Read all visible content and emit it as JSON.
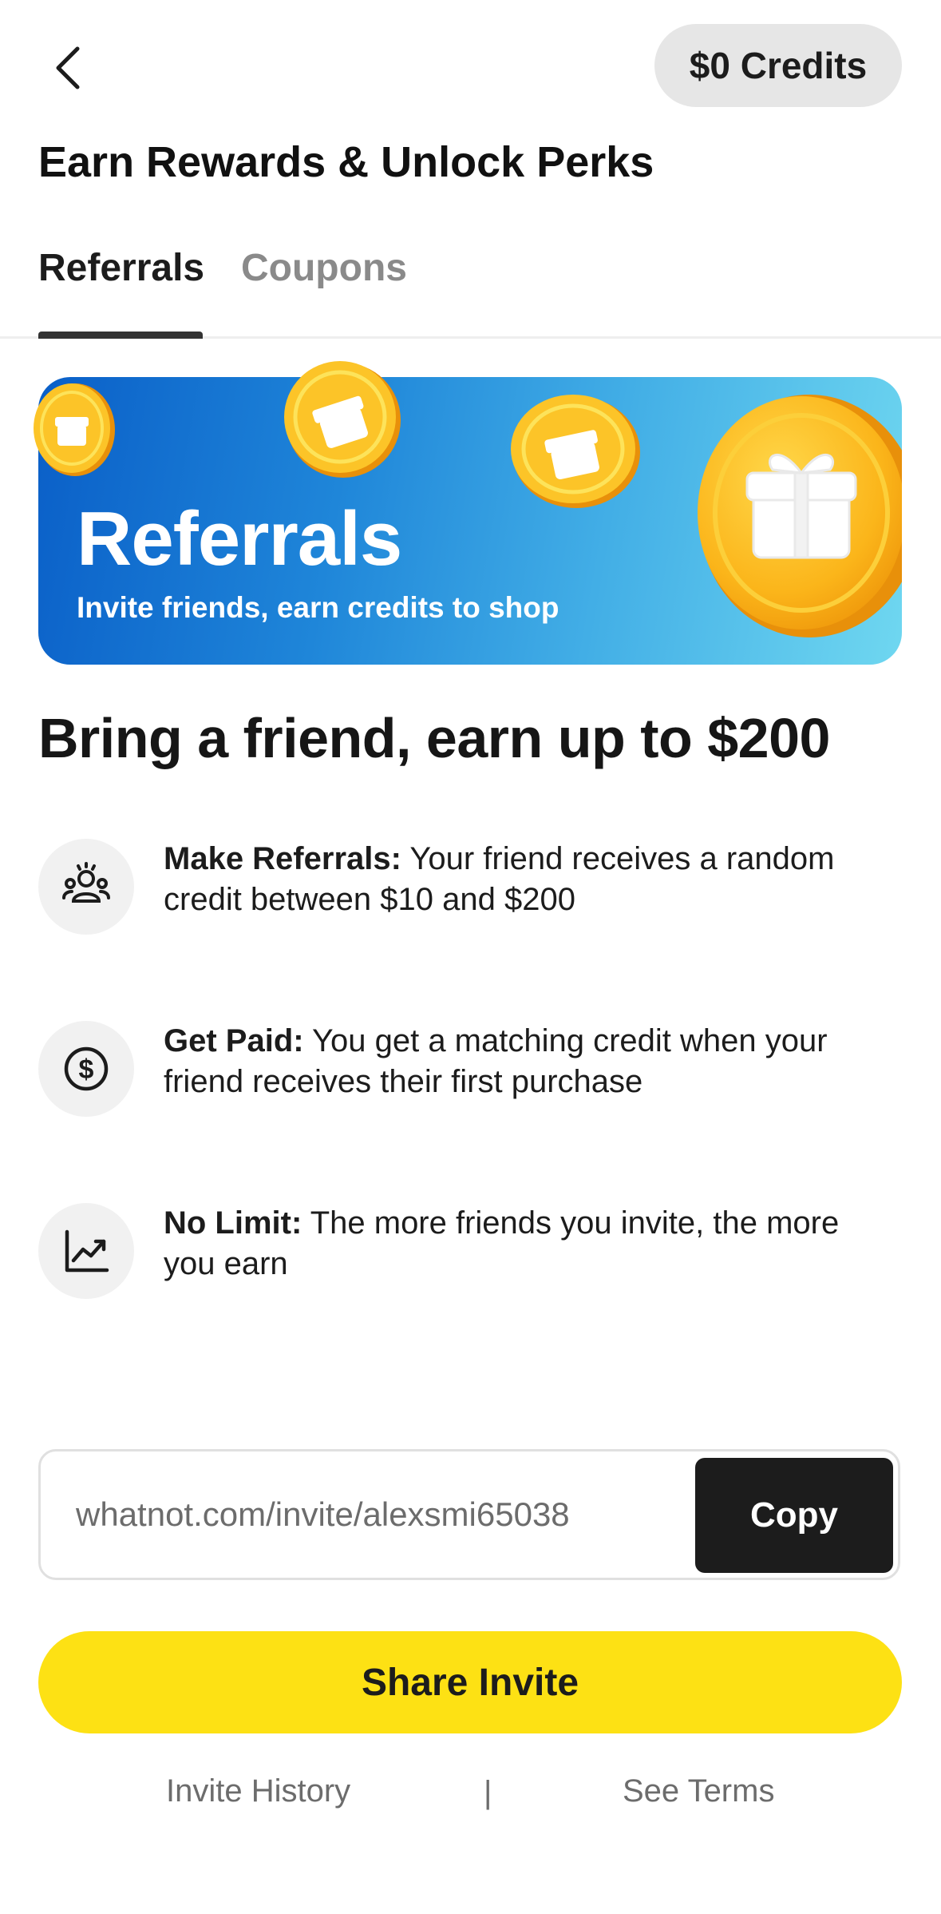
{
  "header": {
    "back_icon": "chevron-left-icon",
    "credits_label": "$0 Credits",
    "title": "Earn Rewards & Unlock Perks"
  },
  "tabs": [
    {
      "label": "Referrals",
      "active": true
    },
    {
      "label": "Coupons",
      "active": false
    }
  ],
  "banner": {
    "title": "Referrals",
    "subtitle": "Invite friends, earn credits to shop",
    "coin_icon": "gift-coin-icon",
    "gradient": [
      "#0a5fc8",
      "#6fd7f0"
    ]
  },
  "headline": "Bring a friend, earn up to $200",
  "features": [
    {
      "icon": "people-icon",
      "title": "Make Referrals:",
      "text": " Your friend receives a random credit between $10 and $200"
    },
    {
      "icon": "dollar-circle-icon",
      "title": "Get Paid:",
      "text": " You get a matching credit when your friend receives their first purchase"
    },
    {
      "icon": "trending-up-icon",
      "title": "No Limit:",
      "text": " The more friends you invite, the more you earn"
    }
  ],
  "invite": {
    "url": "whatnot.com/invite/alexsmi65038",
    "copy_label": "Copy"
  },
  "share_label": "Share Invite",
  "footer": {
    "history_label": "Invite History",
    "separator": "|",
    "terms_label": "See Terms"
  },
  "colors": {
    "accent_yellow": "#fde114",
    "dark": "#1c1c1c",
    "muted": "#8a8a8a"
  }
}
